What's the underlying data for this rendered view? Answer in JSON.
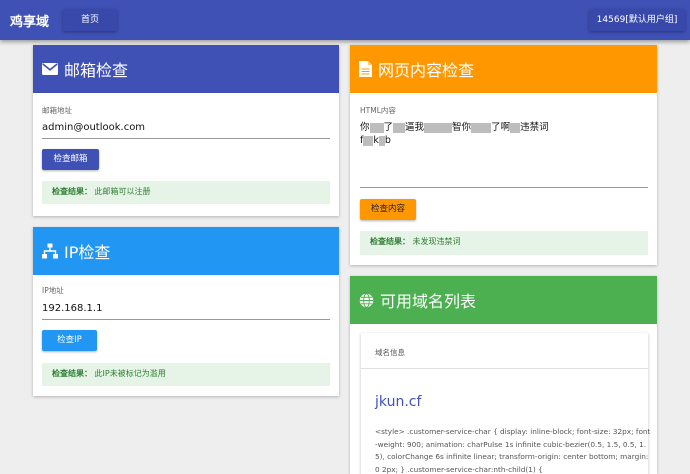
{
  "topbar": {
    "brand": "鸡享域",
    "home_label": "首页",
    "user_label": "14569[默认用户组]"
  },
  "colors": {
    "primary": "#3f51b5",
    "info": "#2196f3",
    "warning": "#ff9800",
    "success": "#4caf50",
    "result_bg": "#e6f4e7",
    "result_text": "#2e7d32"
  },
  "email_check": {
    "title": "邮箱检查",
    "icon": "envelope-icon",
    "field_label": "邮箱地址",
    "field_value": "admin@outlook.com",
    "button_label": "检查邮箱",
    "result_label": "检查结果：",
    "result_text": "此邮箱可以注册"
  },
  "ip_check": {
    "title": "IP检查",
    "icon": "network-icon",
    "field_label": "IP地址",
    "field_value": "192.168.1.1",
    "button_label": "检查IP",
    "result_label": "检查结果：",
    "result_text": "此IP未被标记为滥用"
  },
  "content_check": {
    "title": "网页内容检查",
    "icon": "document-icon",
    "field_label": "HTML内容",
    "text_parts": [
      "你",
      "了",
      "逼我",
      "智你",
      "了啊",
      "违禁词"
    ],
    "line2_parts": [
      "f",
      "k",
      "b"
    ],
    "button_label": "检查内容",
    "result_label": "检查结果：",
    "result_text": "未发现违禁词"
  },
  "domain_list": {
    "title": "可用域名列表",
    "icon": "globe-icon",
    "info_header": "域名信息",
    "domain_name": "jkun.cf",
    "description": "<style> .customer-service-char { display: inline-block; font-size: 32px; font-weight: 900; animation: charPulse 1s infinite cubic-bezier(0.5, 1.5, 0.5, 1.5), colorChange 6s infinite linear; transform-origin: center bottom; margin: 0 2px; } .customer-service-char:nth-child(1) {"
  }
}
